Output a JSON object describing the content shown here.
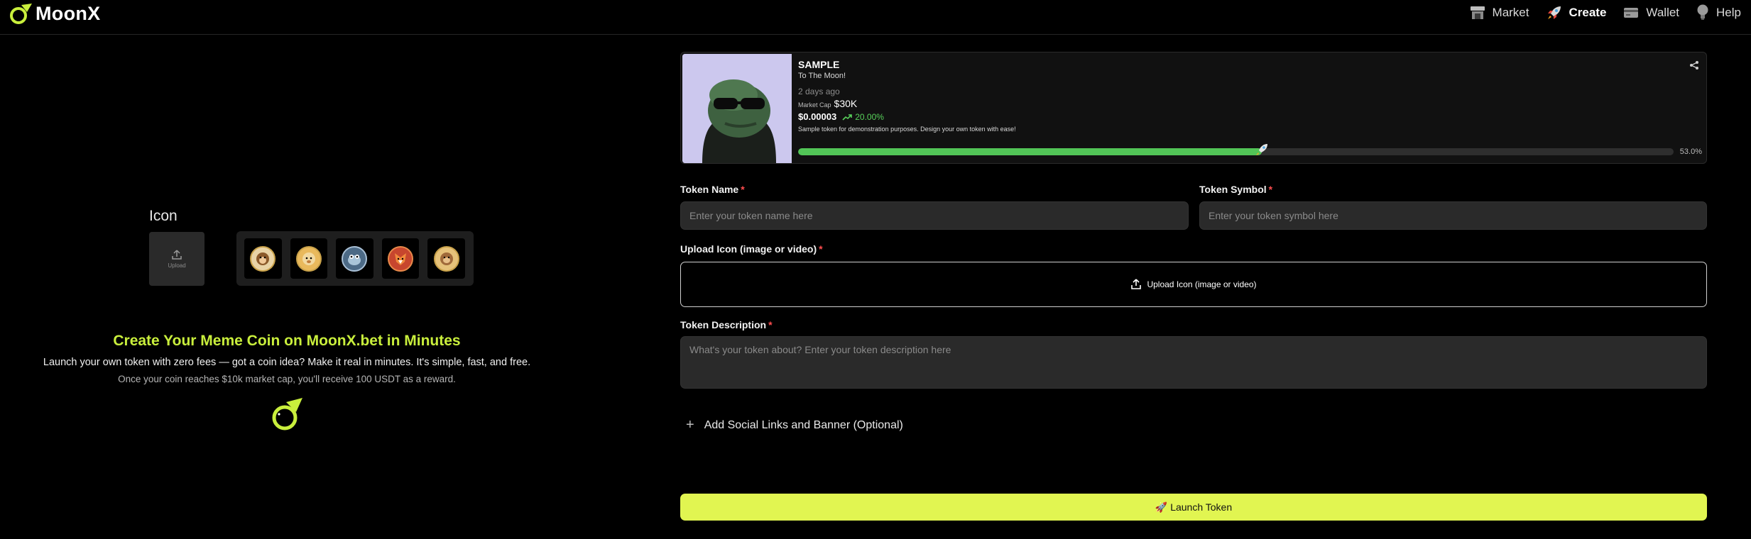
{
  "header": {
    "brand": "MoonX",
    "nav": [
      {
        "label": "Market",
        "icon": "store-icon"
      },
      {
        "label": "Create",
        "icon": "rocket-icon"
      },
      {
        "label": "Wallet",
        "icon": "wallet-icon"
      },
      {
        "label": "Help",
        "icon": "lightbulb-icon"
      }
    ]
  },
  "left": {
    "icon_label": "Icon",
    "upload_label": "Upload",
    "presets": [
      "monkey-coin-icon",
      "doge-coin-icon",
      "frog-coin-icon",
      "fox-coin-icon",
      "ape-coin-icon"
    ],
    "headline": "Create Your Meme Coin on MoonX.bet in Minutes",
    "subline": "Launch your own token with zero fees — got a coin idea? Make it real in minutes. It's simple, fast, and free.",
    "reward": "Once your coin reaches $10k market cap, you'll receive 100 USDT as a reward."
  },
  "card": {
    "name": "SAMPLE",
    "tagline": "To The Moon!",
    "time": "2 days ago",
    "market_cap_label": "Market Cap",
    "market_cap": "$30K",
    "price": "$0.00003",
    "change": "20.00%",
    "description": "Sample token for demonstration purposes. Design your own token with ease!",
    "progress": 53.0,
    "progress_label": "53.0%"
  },
  "form": {
    "token_name_label": "Token Name",
    "token_name_placeholder": "Enter your token name here",
    "token_symbol_label": "Token Symbol",
    "token_symbol_placeholder": "Enter your token symbol here",
    "upload_label": "Upload Icon (image or video)",
    "upload_button": "Upload Icon (image or video)",
    "description_label": "Token Description",
    "description_placeholder": "What's your token about? Enter your token description here",
    "required_mark": "*",
    "social_label": "Add Social Links and Banner (Optional)",
    "social_plus": "+",
    "launch_label": "🚀 Launch Token"
  },
  "colors": {
    "accent": "#e1f551",
    "headline": "#c9ef3c",
    "positive": "#52c557",
    "required": "#ff4d4f"
  }
}
